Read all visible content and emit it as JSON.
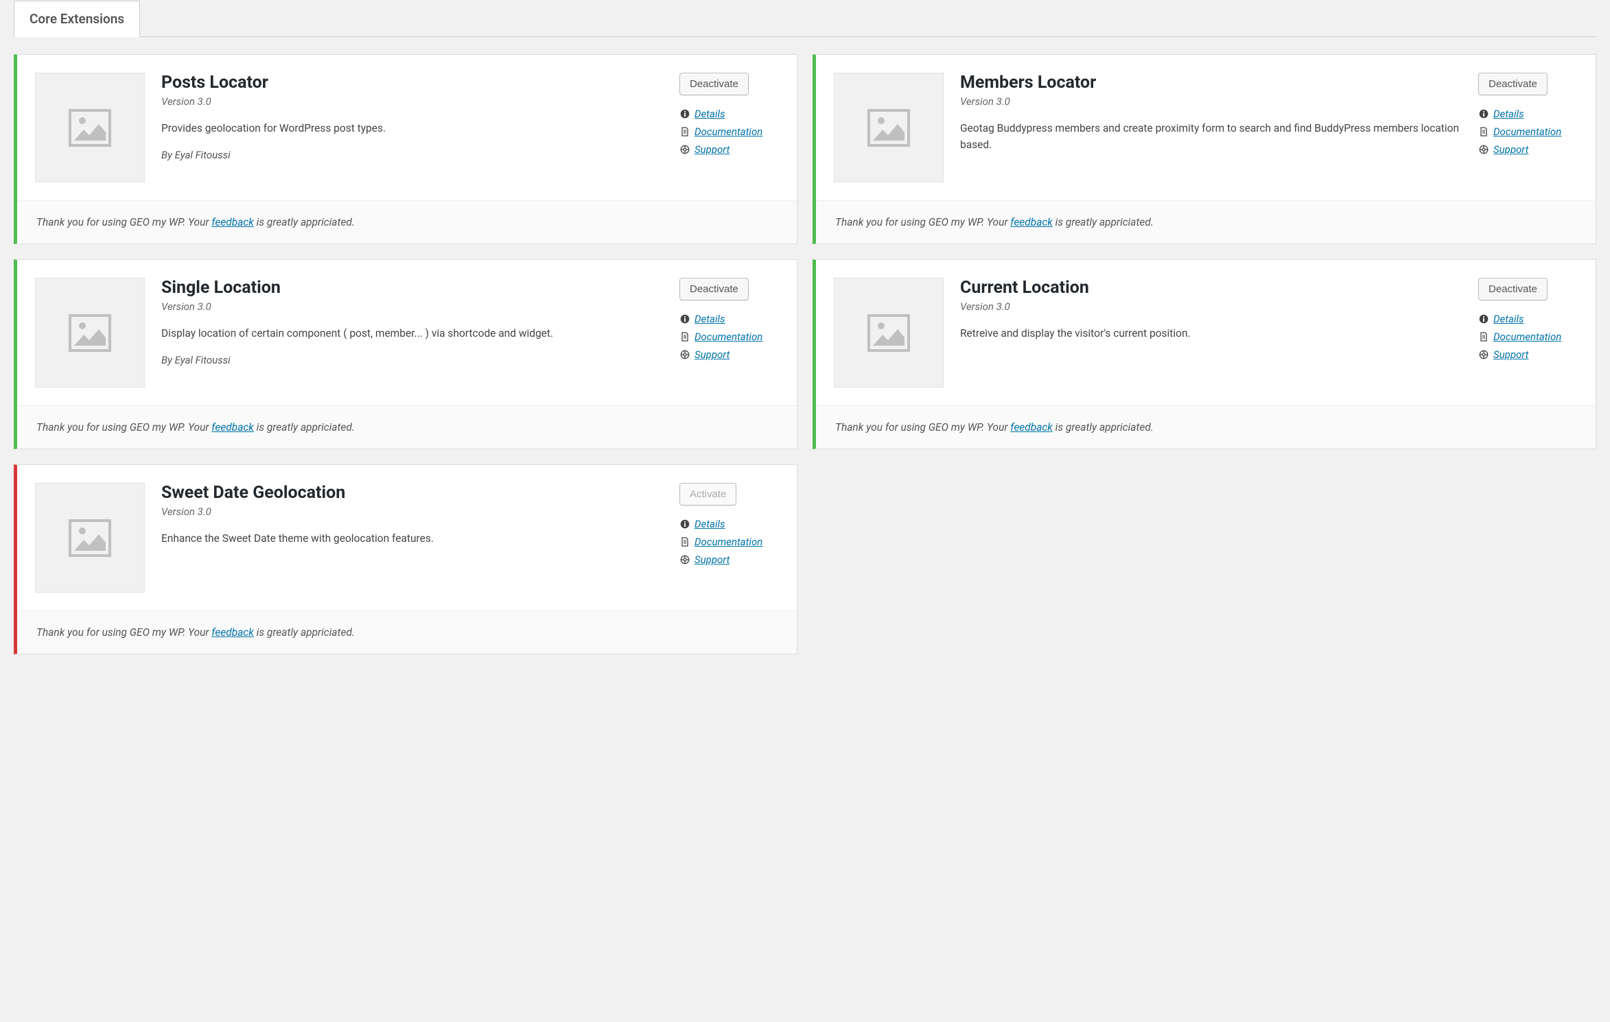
{
  "tab": {
    "label": "Core Extensions"
  },
  "common": {
    "version_prefix": "Version ",
    "author_prefix": "By ",
    "deactivate_label": "Deactivate",
    "activate_label": "Activate",
    "details_label": "Details",
    "documentation_label": "Documentation",
    "support_label": "Support",
    "footer_pre": "Thank you for using GEO my WP. Your ",
    "footer_link": "feedback",
    "footer_post": " is greatly appriciated."
  },
  "cards": [
    {
      "title": "Posts Locator",
      "version": "3.0",
      "desc": "Provides geolocation for WordPress post types.",
      "author": "Eyal Fitoussi",
      "active": true,
      "button": "deactivate"
    },
    {
      "title": "Members Locator",
      "version": "3.0",
      "desc": "Geotag Buddypress members and create proximity form to search and find BuddyPress members location based.",
      "author": "",
      "active": true,
      "button": "deactivate"
    },
    {
      "title": "Single Location",
      "version": "3.0",
      "desc": "Display location of certain component ( post, member... ) via shortcode and widget.",
      "author": "Eyal Fitoussi",
      "active": true,
      "button": "deactivate"
    },
    {
      "title": "Current Location",
      "version": "3.0",
      "desc": "Retreive and display the visitor's current position.",
      "author": "",
      "active": true,
      "button": "deactivate"
    },
    {
      "title": "Sweet Date Geolocation",
      "version": "3.0",
      "desc": "Enhance the Sweet Date theme with geolocation features.",
      "author": "",
      "active": false,
      "button": "activate"
    }
  ]
}
